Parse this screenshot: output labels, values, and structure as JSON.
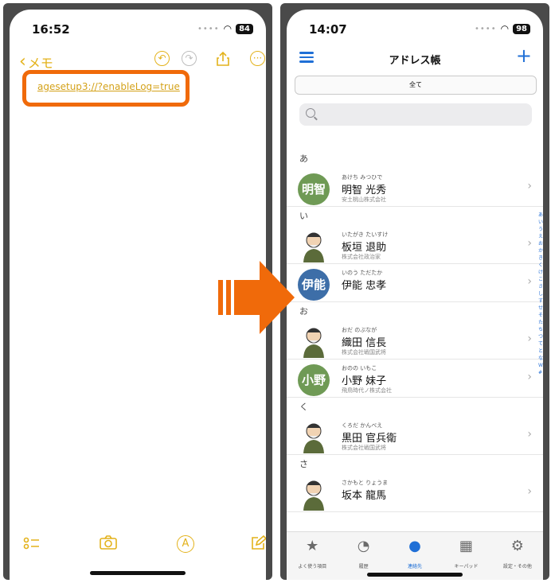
{
  "left_phone": {
    "status_time": "16:52",
    "battery": "84",
    "back_label": "メモ",
    "note_link": "agesetup3://?enableLog=true"
  },
  "right_phone": {
    "status_time": "14:07",
    "battery": "98",
    "title": "アドレス帳",
    "segment_label": "全て",
    "sections": [
      {
        "header": "あ",
        "contacts": [
          {
            "kana": "あけち みつひで",
            "name": "明智 光秀",
            "company": "安土桃山株式会社",
            "avatar_text": "明智",
            "avatar_color": "#6f9a55"
          }
        ]
      },
      {
        "header": "い",
        "contacts": [
          {
            "kana": "いたがき たいすけ",
            "name": "板垣 退助",
            "company": "株式会社政治家",
            "avatar_text": "",
            "avatar_color": ""
          },
          {
            "kana": "いのう ただたか",
            "name": "伊能 忠孝",
            "company": "",
            "avatar_text": "伊能",
            "avatar_color": "#3d6ea8"
          }
        ]
      },
      {
        "header": "お",
        "contacts": [
          {
            "kana": "おだ のぶなが",
            "name": "織田 信長",
            "company": "株式会社戦国武将",
            "avatar_text": "",
            "avatar_color": ""
          },
          {
            "kana": "おのの いもこ",
            "name": "小野 妹子",
            "company": "飛鳥時代ノ株式会社",
            "avatar_text": "小野",
            "avatar_color": "#6f9a55"
          }
        ]
      },
      {
        "header": "く",
        "contacts": [
          {
            "kana": "くろだ かんべえ",
            "name": "黒田 官兵衛",
            "company": "株式会社戦国武将",
            "avatar_text": "",
            "avatar_color": ""
          }
        ]
      },
      {
        "header": "さ",
        "contacts": [
          {
            "kana": "さかもと りょうま",
            "name": "坂本 龍馬",
            "company": "",
            "avatar_text": "",
            "avatar_color": ""
          }
        ]
      }
    ],
    "tabs": [
      {
        "label": "よく使う項目",
        "icon": "star-icon"
      },
      {
        "label": "履歴",
        "icon": "clock-icon"
      },
      {
        "label": "連絡先",
        "icon": "person-icon"
      },
      {
        "label": "キーパッド",
        "icon": "keypad-icon"
      },
      {
        "label": "設定・その他",
        "icon": "gear-icon"
      }
    ],
    "active_tab": "連絡先"
  },
  "colors": {
    "notes_accent": "#e3b21b",
    "highlight_orange": "#f06a0a",
    "ios_blue": "#1f6fd6"
  }
}
